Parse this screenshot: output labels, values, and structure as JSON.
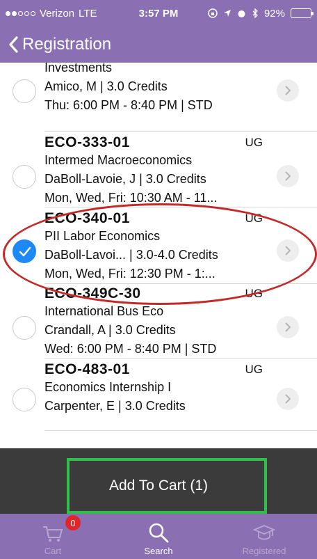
{
  "status": {
    "carrier": "Verizon",
    "network": "LTE",
    "time": "3:57 PM",
    "battery": "92%",
    "battery_level": 0.92,
    "signal_bars": 2
  },
  "nav": {
    "title": "Registration"
  },
  "courses": [
    {
      "code": "",
      "level": "",
      "title": "Investments",
      "instructor_line": "Amico, M  | 3.0 Credits",
      "schedule": "Thu: 6:00 PM - 8:40 PM  | STD",
      "selected": false
    },
    {
      "code": "ECO-333-01",
      "level": "UG",
      "title": "Intermed Macroeconomics",
      "instructor_line": "DaBoll-Lavoie, J  | 3.0 Credits",
      "schedule": "Mon, Wed, Fri: 10:30 AM - 11...",
      "selected": false
    },
    {
      "code": "ECO-340-01",
      "level": "UG",
      "title": "PII Labor Economics",
      "instructor_line": "DaBoll-Lavoi...  | 3.0-4.0 Credits",
      "schedule": "Mon, Wed, Fri: 12:30 PM - 1:...",
      "selected": true
    },
    {
      "code": "ECO-349C-30",
      "level": "UG",
      "title": "International Bus Eco",
      "instructor_line": "Crandall, A  | 3.0 Credits",
      "schedule": "Wed: 6:00 PM - 8:40 PM  | STD",
      "selected": false
    },
    {
      "code": "ECO-483-01",
      "level": "UG",
      "title": "Economics Internship I",
      "instructor_line": "Carpenter, E  | 3.0 Credits",
      "schedule": "",
      "selected": false
    }
  ],
  "cart_button": {
    "label": "Add To Cart (1)"
  },
  "tabs": [
    {
      "label": "Cart",
      "icon": "cart-icon",
      "badge": "0",
      "active": false
    },
    {
      "label": "Search",
      "icon": "search-icon",
      "active": true
    },
    {
      "label": "Registered",
      "icon": "graduation-cap-icon",
      "active": false
    }
  ],
  "colors": {
    "brand": "#8a6fb2",
    "selected": "#1e88f5",
    "annotation_red": "#c42a2a",
    "annotation_green": "#2fbf4a",
    "badge": "#e0262b"
  }
}
